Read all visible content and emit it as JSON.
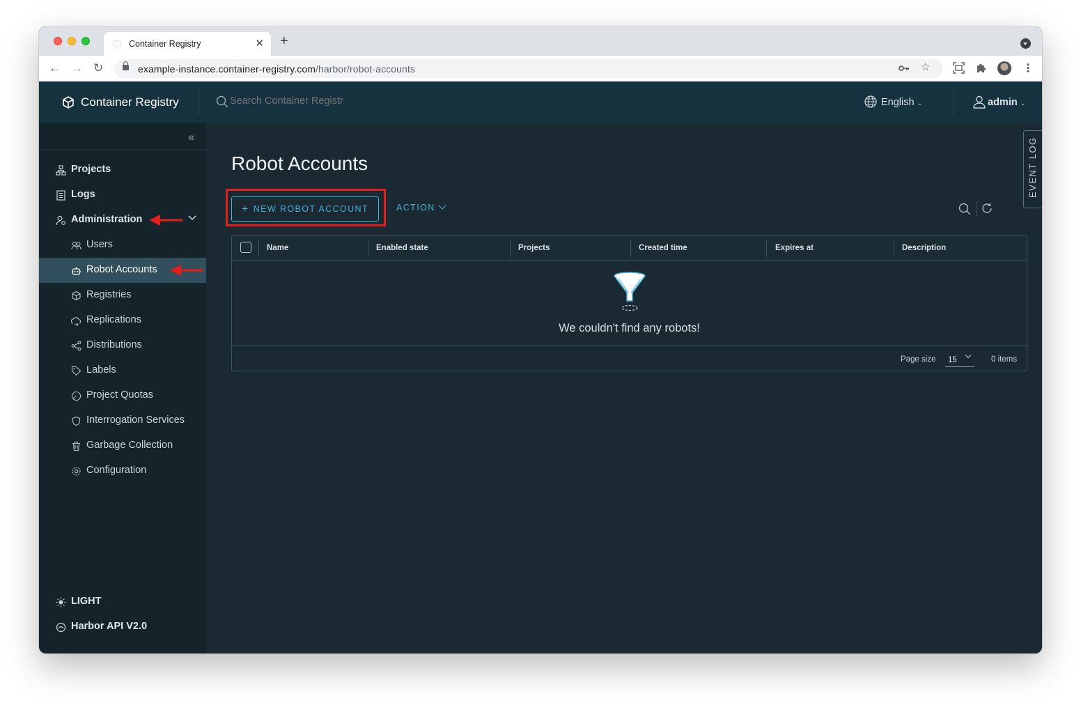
{
  "browser": {
    "tab_title": "Container Registry",
    "url_host": "example-instance.container-registry.com",
    "url_path": "/harbor/robot-accounts"
  },
  "header": {
    "brand": "Container Registry",
    "search_placeholder": "Search Container Registr",
    "language": "English",
    "user": "admin"
  },
  "sidebar": {
    "items": [
      {
        "label": "Projects",
        "icon": "projects-icon"
      },
      {
        "label": "Logs",
        "icon": "logs-icon"
      },
      {
        "label": "Administration",
        "icon": "administration-icon",
        "expanded": true
      }
    ],
    "admin_items": [
      {
        "label": "Users",
        "icon": "users-icon"
      },
      {
        "label": "Robot Accounts",
        "icon": "robot-icon",
        "active": true
      },
      {
        "label": "Registries",
        "icon": "registries-icon"
      },
      {
        "label": "Replications",
        "icon": "replications-icon"
      },
      {
        "label": "Distributions",
        "icon": "distributions-icon"
      },
      {
        "label": "Labels",
        "icon": "labels-icon"
      },
      {
        "label": "Project Quotas",
        "icon": "quotas-icon"
      },
      {
        "label": "Interrogation Services",
        "icon": "shield-icon"
      },
      {
        "label": "Garbage Collection",
        "icon": "trash-icon"
      },
      {
        "label": "Configuration",
        "icon": "gear-icon"
      }
    ],
    "theme_toggle": "LIGHT",
    "api_link": "Harbor API V2.0"
  },
  "main": {
    "title": "Robot Accounts",
    "new_button": "NEW ROBOT ACCOUNT",
    "action_button": "ACTION",
    "event_log": "EVENT LOG",
    "columns": [
      "Name",
      "Enabled state",
      "Projects",
      "Created time",
      "Expires at",
      "Description"
    ],
    "empty_message": "We couldn't find any robots!",
    "page_size_label": "Page size",
    "page_size_value": "15",
    "item_count": "0 items"
  },
  "colors": {
    "header_bg": "#17323f",
    "sidebar_bg": "#15232b",
    "main_bg": "#1b2a32",
    "accent": "#49afd9",
    "annotation_red": "#e0201b"
  }
}
